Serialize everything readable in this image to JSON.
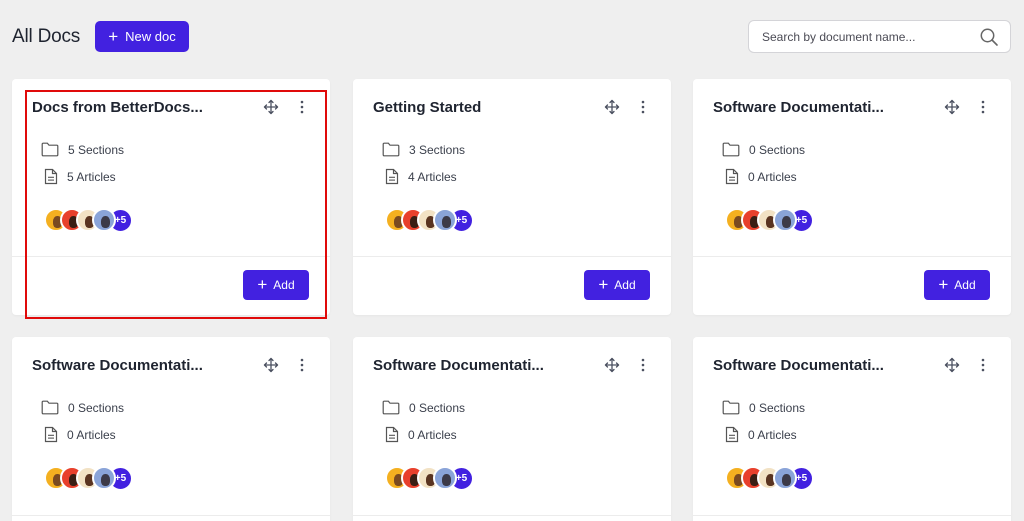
{
  "header": {
    "title": "All Docs",
    "new_doc_label": "New doc",
    "search_placeholder": "Search by document name...",
    "search_value": ""
  },
  "avatars_more_label": "+5",
  "add_label": "Add",
  "cards": [
    {
      "title": "Docs from BetterDocs...",
      "sections": "5 Sections",
      "articles": "5 Articles"
    },
    {
      "title": "Getting Started",
      "sections": "3 Sections",
      "articles": "4 Articles"
    },
    {
      "title": "Software Documentati...",
      "sections": "0 Sections",
      "articles": "0 Articles"
    },
    {
      "title": "Software Documentati...",
      "sections": "0 Sections",
      "articles": "0 Articles"
    },
    {
      "title": "Software Documentati...",
      "sections": "0 Sections",
      "articles": "0 Articles"
    },
    {
      "title": "Software Documentati...",
      "sections": "0 Sections",
      "articles": "0 Articles"
    }
  ],
  "colors": {
    "accent": "#4221e0",
    "page_background": "#efefef",
    "highlight_border": "#e00a0a",
    "avatar_backgrounds": [
      "#f4b020",
      "#e8402c",
      "#f2e2c4",
      "#8aa4d8"
    ]
  },
  "icons": {
    "folder": "folder-icon",
    "document": "document-icon",
    "move": "move-icon",
    "more": "kebab-menu-icon",
    "search": "search-icon",
    "plus": "plus-icon"
  }
}
